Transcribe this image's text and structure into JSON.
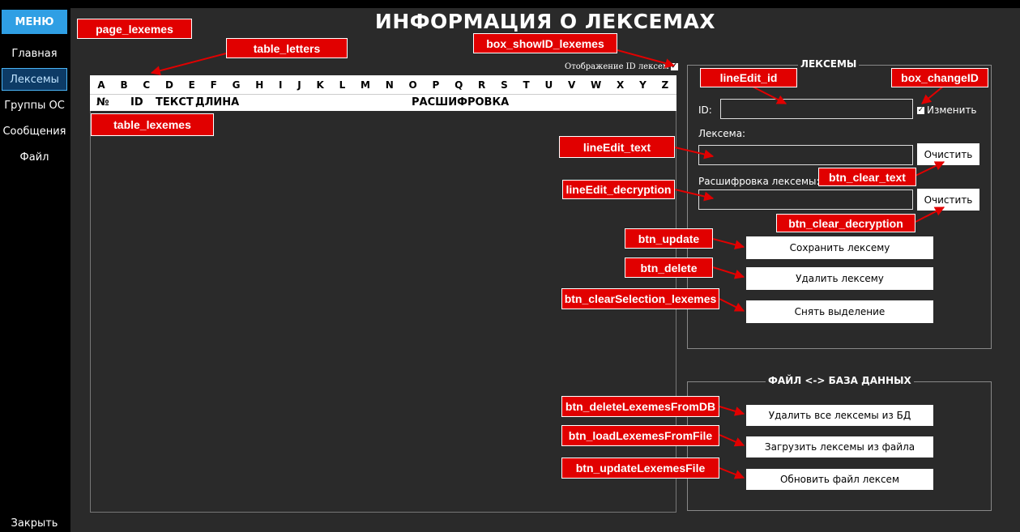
{
  "sidebar": {
    "menu_label": "МЕНЮ",
    "items": [
      {
        "label": "Главная"
      },
      {
        "label": "Лексемы"
      },
      {
        "label": "Группы ОС"
      },
      {
        "label": "Сообщения"
      },
      {
        "label": "Файл"
      }
    ],
    "close_label": "Закрыть"
  },
  "page": {
    "title": "ИНФОРМАЦИЯ О ЛЕКСЕМАХ",
    "show_id_label": "Отображение ID лексем",
    "letters": [
      "A",
      "B",
      "C",
      "D",
      "E",
      "F",
      "G",
      "H",
      "I",
      "J",
      "K",
      "L",
      "M",
      "N",
      "O",
      "P",
      "Q",
      "R",
      "S",
      "T",
      "U",
      "V",
      "W",
      "X",
      "Y",
      "Z"
    ],
    "table_columns": [
      "№",
      "ID",
      "ТЕКСТ",
      "ДЛИНА",
      "РАСШИФРОВКА"
    ]
  },
  "lexeme_form": {
    "group_title": "ЛЕКСЕМЫ",
    "id_label": "ID:",
    "id_value": "",
    "change_label": "Изменить",
    "lexeme_label": "Лексема:",
    "text_value": "",
    "decryption_label": "Расшифровка лексемы:",
    "decryption_value": "",
    "clear_label": "Очистить",
    "clear_label2": "Очистить",
    "save_label": "Сохранить лексему",
    "delete_label": "Удалить лексему",
    "deselect_label": "Снять выделение"
  },
  "file_db": {
    "group_title": "ФАЙЛ <-> БАЗА ДАННЫХ",
    "delete_all_label": "Удалить все лексемы из БД",
    "load_label": "Загрузить лексемы из файла",
    "update_label": "Обновить файл лексем"
  },
  "annotations": {
    "page_lexemes": "page_lexemes",
    "table_letters": "table_letters",
    "box_showID_lexemes": "box_showID_lexemes",
    "table_lexemes": "table_lexemes",
    "lineEdit_id": "lineEdit_id",
    "box_changeID": "box_changeID",
    "lineEdit_text": "lineEdit_text",
    "btn_clear_text": "btn_clear_text",
    "lineEdit_decryption": "lineEdit_decryption",
    "btn_clear_decryption": "btn_clear_decryption",
    "btn_update": "btn_update",
    "btn_delete": "btn_delete",
    "btn_clearSelection_lexemes": "btn_clearSelection_lexemes",
    "btn_deleteLexemesFromDB": "btn_deleteLexemesFromDB",
    "btn_loadLexemesFromFile": "btn_loadLexemesFromFile",
    "btn_updateLexemesFile": "btn_updateLexemesFile"
  },
  "colors": {
    "accent": "#2f9fe4",
    "annotation": "#e10000",
    "page_bg": "#2a2a2a"
  }
}
